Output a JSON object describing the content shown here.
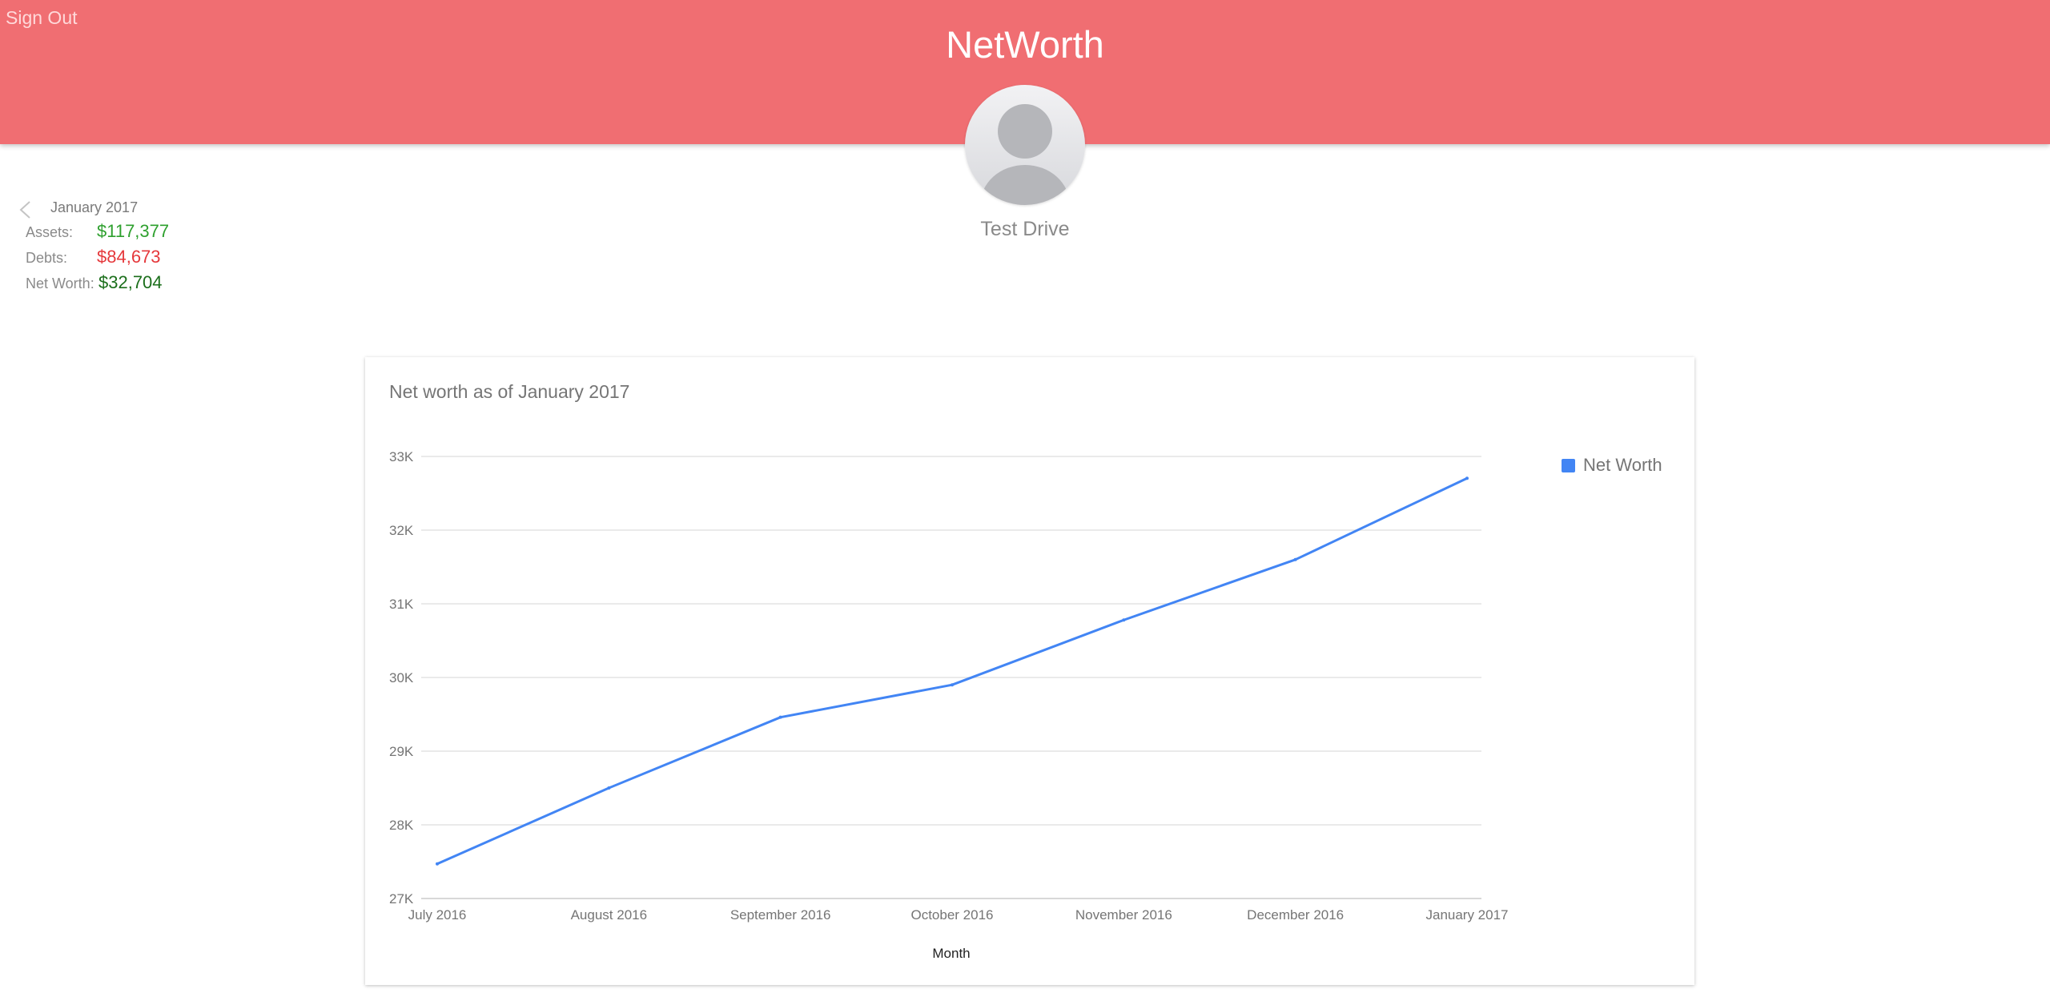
{
  "header": {
    "sign_out_label": "Sign Out",
    "app_title": "NetWorth",
    "background_color": "#f06e72"
  },
  "profile": {
    "avatar_icon": "user-avatar-placeholder-icon",
    "name": "Test Drive"
  },
  "summary": {
    "prev_icon": "chevron-left-icon",
    "period": "January 2017",
    "assets_label": "Assets:",
    "assets_value": "$117,377",
    "assets_color": "#2ea02e",
    "debts_label": "Debts:",
    "debts_value": "$84,673",
    "debts_color": "#e5383b",
    "net_worth_label": "Net Worth:",
    "net_worth_value": "$32,704",
    "net_worth_color": "#1b6e1b"
  },
  "chart_data": {
    "type": "line",
    "title": "Net worth as of January 2017",
    "xlabel": "Month",
    "ylabel": "",
    "categories": [
      "July 2016",
      "August 2016",
      "September 2016",
      "October 2016",
      "November 2016",
      "December 2016",
      "January 2017"
    ],
    "series": [
      {
        "name": "Net Worth",
        "color": "#4285f4",
        "values": [
          27470,
          28500,
          29460,
          29900,
          30780,
          31600,
          32704
        ]
      }
    ],
    "ylim": [
      27000,
      33000
    ],
    "yticks": [
      27000,
      28000,
      29000,
      30000,
      31000,
      32000,
      33000
    ],
    "ytick_labels": [
      "27K",
      "28K",
      "29K",
      "30K",
      "31K",
      "32K",
      "33K"
    ],
    "grid": true,
    "legend_position": "right"
  }
}
